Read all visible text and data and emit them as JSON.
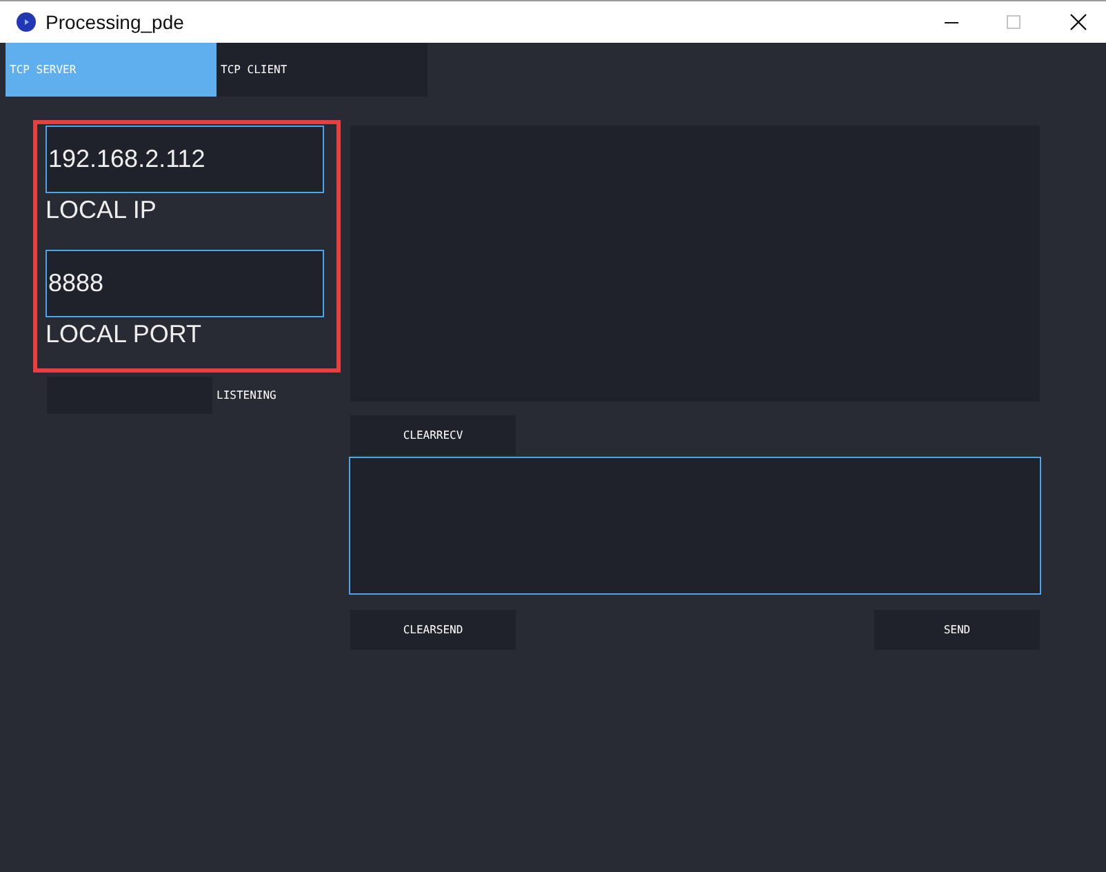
{
  "window": {
    "title": "Processing_pde",
    "maximize_disabled": true
  },
  "tabs": [
    {
      "label": "TCP SERVER",
      "selected": true
    },
    {
      "label": "TCP CLIENT",
      "selected": false
    }
  ],
  "server_settings": {
    "fields": [
      {
        "value": "192.168.2.112",
        "label": "LOCAL IP"
      },
      {
        "value": "8888",
        "label": "LOCAL PORT"
      }
    ],
    "listening_toggle": {
      "label": "LISTENING",
      "on": false
    }
  },
  "receive": {
    "clear_button": "CLEARRECV"
  },
  "send": {
    "clear_button": "CLEARSEND",
    "send_button": "SEND"
  }
}
